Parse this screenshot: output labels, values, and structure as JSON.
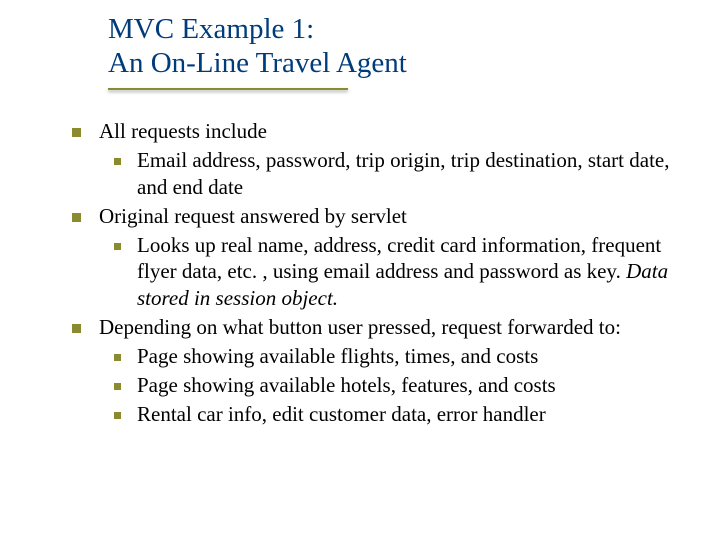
{
  "title": {
    "line1": "MVC Example 1:",
    "line2": "An On-Line Travel Agent"
  },
  "body": {
    "b1": {
      "text": "All requests include",
      "sub": [
        "Email address, password, trip origin, trip destination, start date, and end date"
      ]
    },
    "b2": {
      "text": "Original request answered by servlet",
      "sub": [
        {
          "plain": "Looks up real name, address, credit card information, frequent flyer data, etc. , using email address and password as key. ",
          "italic": "Data stored in session object."
        }
      ]
    },
    "b3": {
      "text": "Depending on what button user pressed, request forwarded to:",
      "sub": [
        "Page showing available flights, times, and costs",
        "Page showing available hotels, features, and costs",
        "Rental car info, edit customer data, error handler"
      ]
    }
  }
}
